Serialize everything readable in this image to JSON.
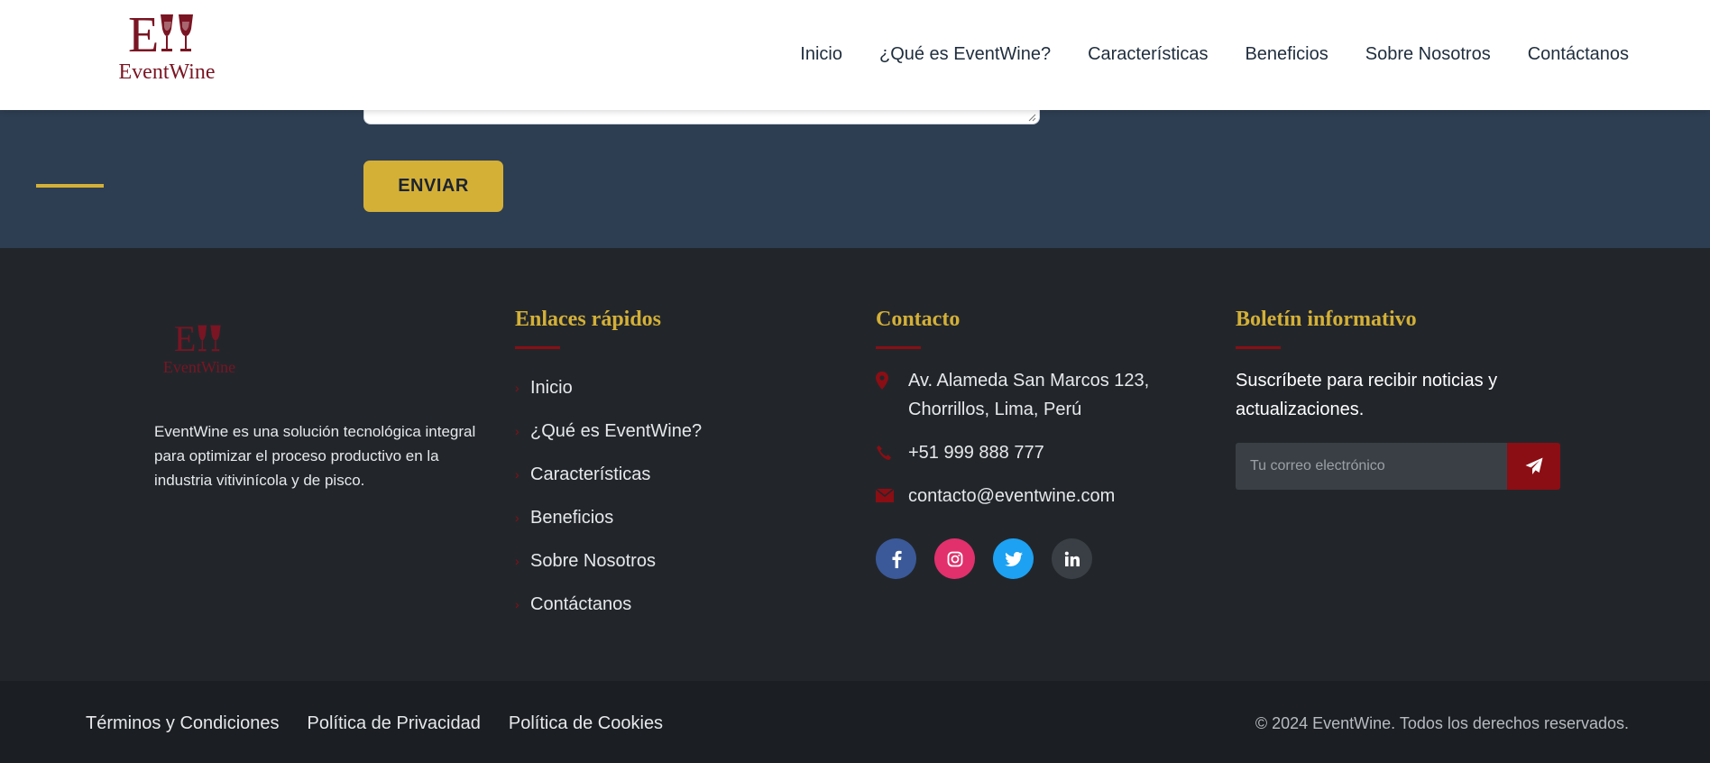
{
  "brand": {
    "name": "EventWine",
    "monogram": "E",
    "color": "#7a1523"
  },
  "nav": [
    "Inicio",
    "¿Qué es EventWine?",
    "Características",
    "Beneficios",
    "Sobre Nosotros",
    "Contáctanos"
  ],
  "form": {
    "submit_label": "ENVIAR",
    "accent": "#d4b037"
  },
  "footer": {
    "about": "EventWine es una solución tecnológica integral para optimizar el proceso productivo en la industria vitivinícola y de pisco.",
    "quick_links": {
      "title": "Enlaces rápidos",
      "items": [
        "Inicio",
        "¿Qué es EventWine?",
        "Características",
        "Beneficios",
        "Sobre Nosotros",
        "Contáctanos"
      ]
    },
    "contact": {
      "title": "Contacto",
      "address_line1": "Av. Alameda San Marcos 123,",
      "address_line2": "Chorrillos, Lima, Perú",
      "phone": "+51 999 888 777",
      "email": "contacto@eventwine.com",
      "social": [
        {
          "name": "facebook-icon",
          "color": "#3b5998"
        },
        {
          "name": "instagram-icon",
          "color": "#e1306c"
        },
        {
          "name": "twitter-icon",
          "color": "#1da1f2"
        },
        {
          "name": "linkedin-icon",
          "color": "#3a3f45"
        }
      ]
    },
    "newsletter": {
      "title": "Boletín informativo",
      "text": "Suscríbete para recibir noticias y actualizaciones.",
      "placeholder": "Tu correo electrónico"
    }
  },
  "bottom": {
    "links": [
      "Términos y Condiciones",
      "Política de Privacidad",
      "Política de Cookies"
    ],
    "copyright": "© 2024 EventWine. Todos los derechos reservados."
  }
}
